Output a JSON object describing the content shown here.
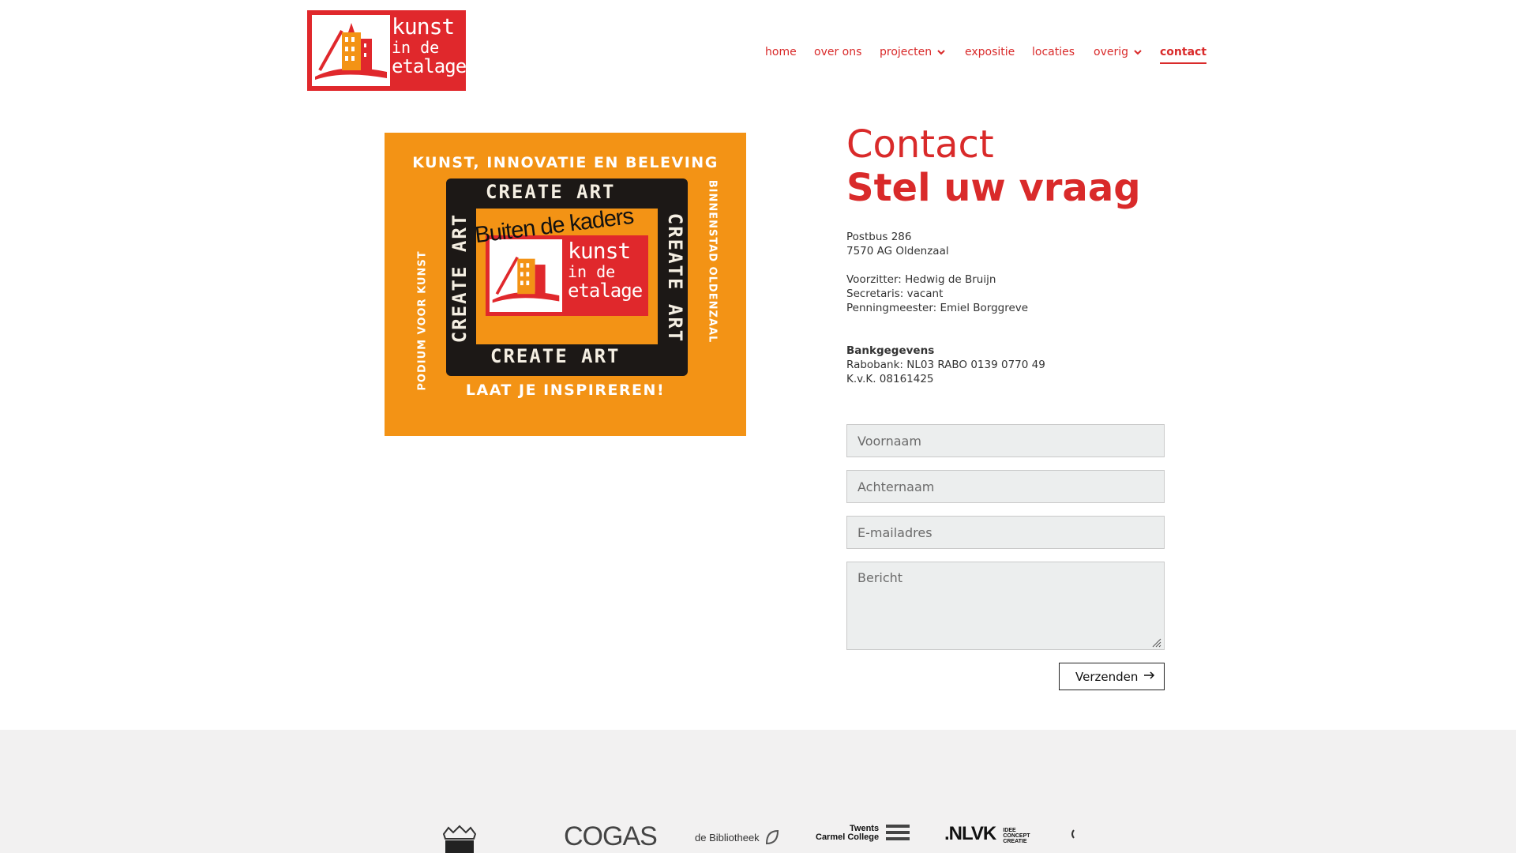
{
  "header": {
    "logo": {
      "line1": "kunst",
      "line2": "in de",
      "line3": "etalage"
    },
    "nav": [
      {
        "label": "home",
        "has_dropdown": false,
        "active": false
      },
      {
        "label": "over ons",
        "has_dropdown": false,
        "active": false
      },
      {
        "label": "projecten",
        "has_dropdown": true,
        "active": false
      },
      {
        "label": "expositie",
        "has_dropdown": false,
        "active": false
      },
      {
        "label": "locaties",
        "has_dropdown": false,
        "active": false
      },
      {
        "label": "overig",
        "has_dropdown": true,
        "active": false
      },
      {
        "label": "contact",
        "has_dropdown": false,
        "active": true
      }
    ]
  },
  "poster": {
    "top": "KUNST, INNOVATIE EN BELEVING",
    "bottom": "LAAT JE INSPIREREN!",
    "left": "PODIUM VOOR KUNST",
    "right": "BINNENSTAD OLDENZAAL",
    "frame_text": "CREATE ART",
    "tagline": "Buiten de kaders",
    "logo": {
      "line1": "kunst",
      "line2": "in de",
      "line3": "etalage"
    }
  },
  "contact": {
    "heading": "Contact",
    "subheading": "Stel uw vraag",
    "address": [
      "Postbus 286",
      "7570 AG Oldenzaal"
    ],
    "board": [
      "Voorzitter: Hedwig de Bruijn",
      "Secretaris: vacant",
      "Penningmeester: Emiel Borggreve"
    ],
    "bank_title": "Bankgegevens",
    "bank": [
      "Rabobank: NL03 RABO 0139 0770 49",
      "K.v.K. 08161425"
    ]
  },
  "form": {
    "firstname_placeholder": "Voornaam",
    "lastname_placeholder": "Achternaam",
    "email_placeholder": "E-mailadres",
    "message_placeholder": "Bericht",
    "submit_label": "Verzenden"
  },
  "footer": {
    "sponsors": {
      "cogas": "COGAS",
      "bibliotheek": "de Bibliotheek",
      "carmel_1": "Twents",
      "carmel_2": "Carmel College",
      "nlvk": ".NLVK",
      "nlvk_1": "IDEE",
      "nlvk_2": "CONCEPT",
      "nlvk_3": "CREATIE"
    }
  },
  "colors": {
    "brand_red": "#d92a2a",
    "poster_orange": "#f39315",
    "footer_bg": "#f2f1f1"
  }
}
